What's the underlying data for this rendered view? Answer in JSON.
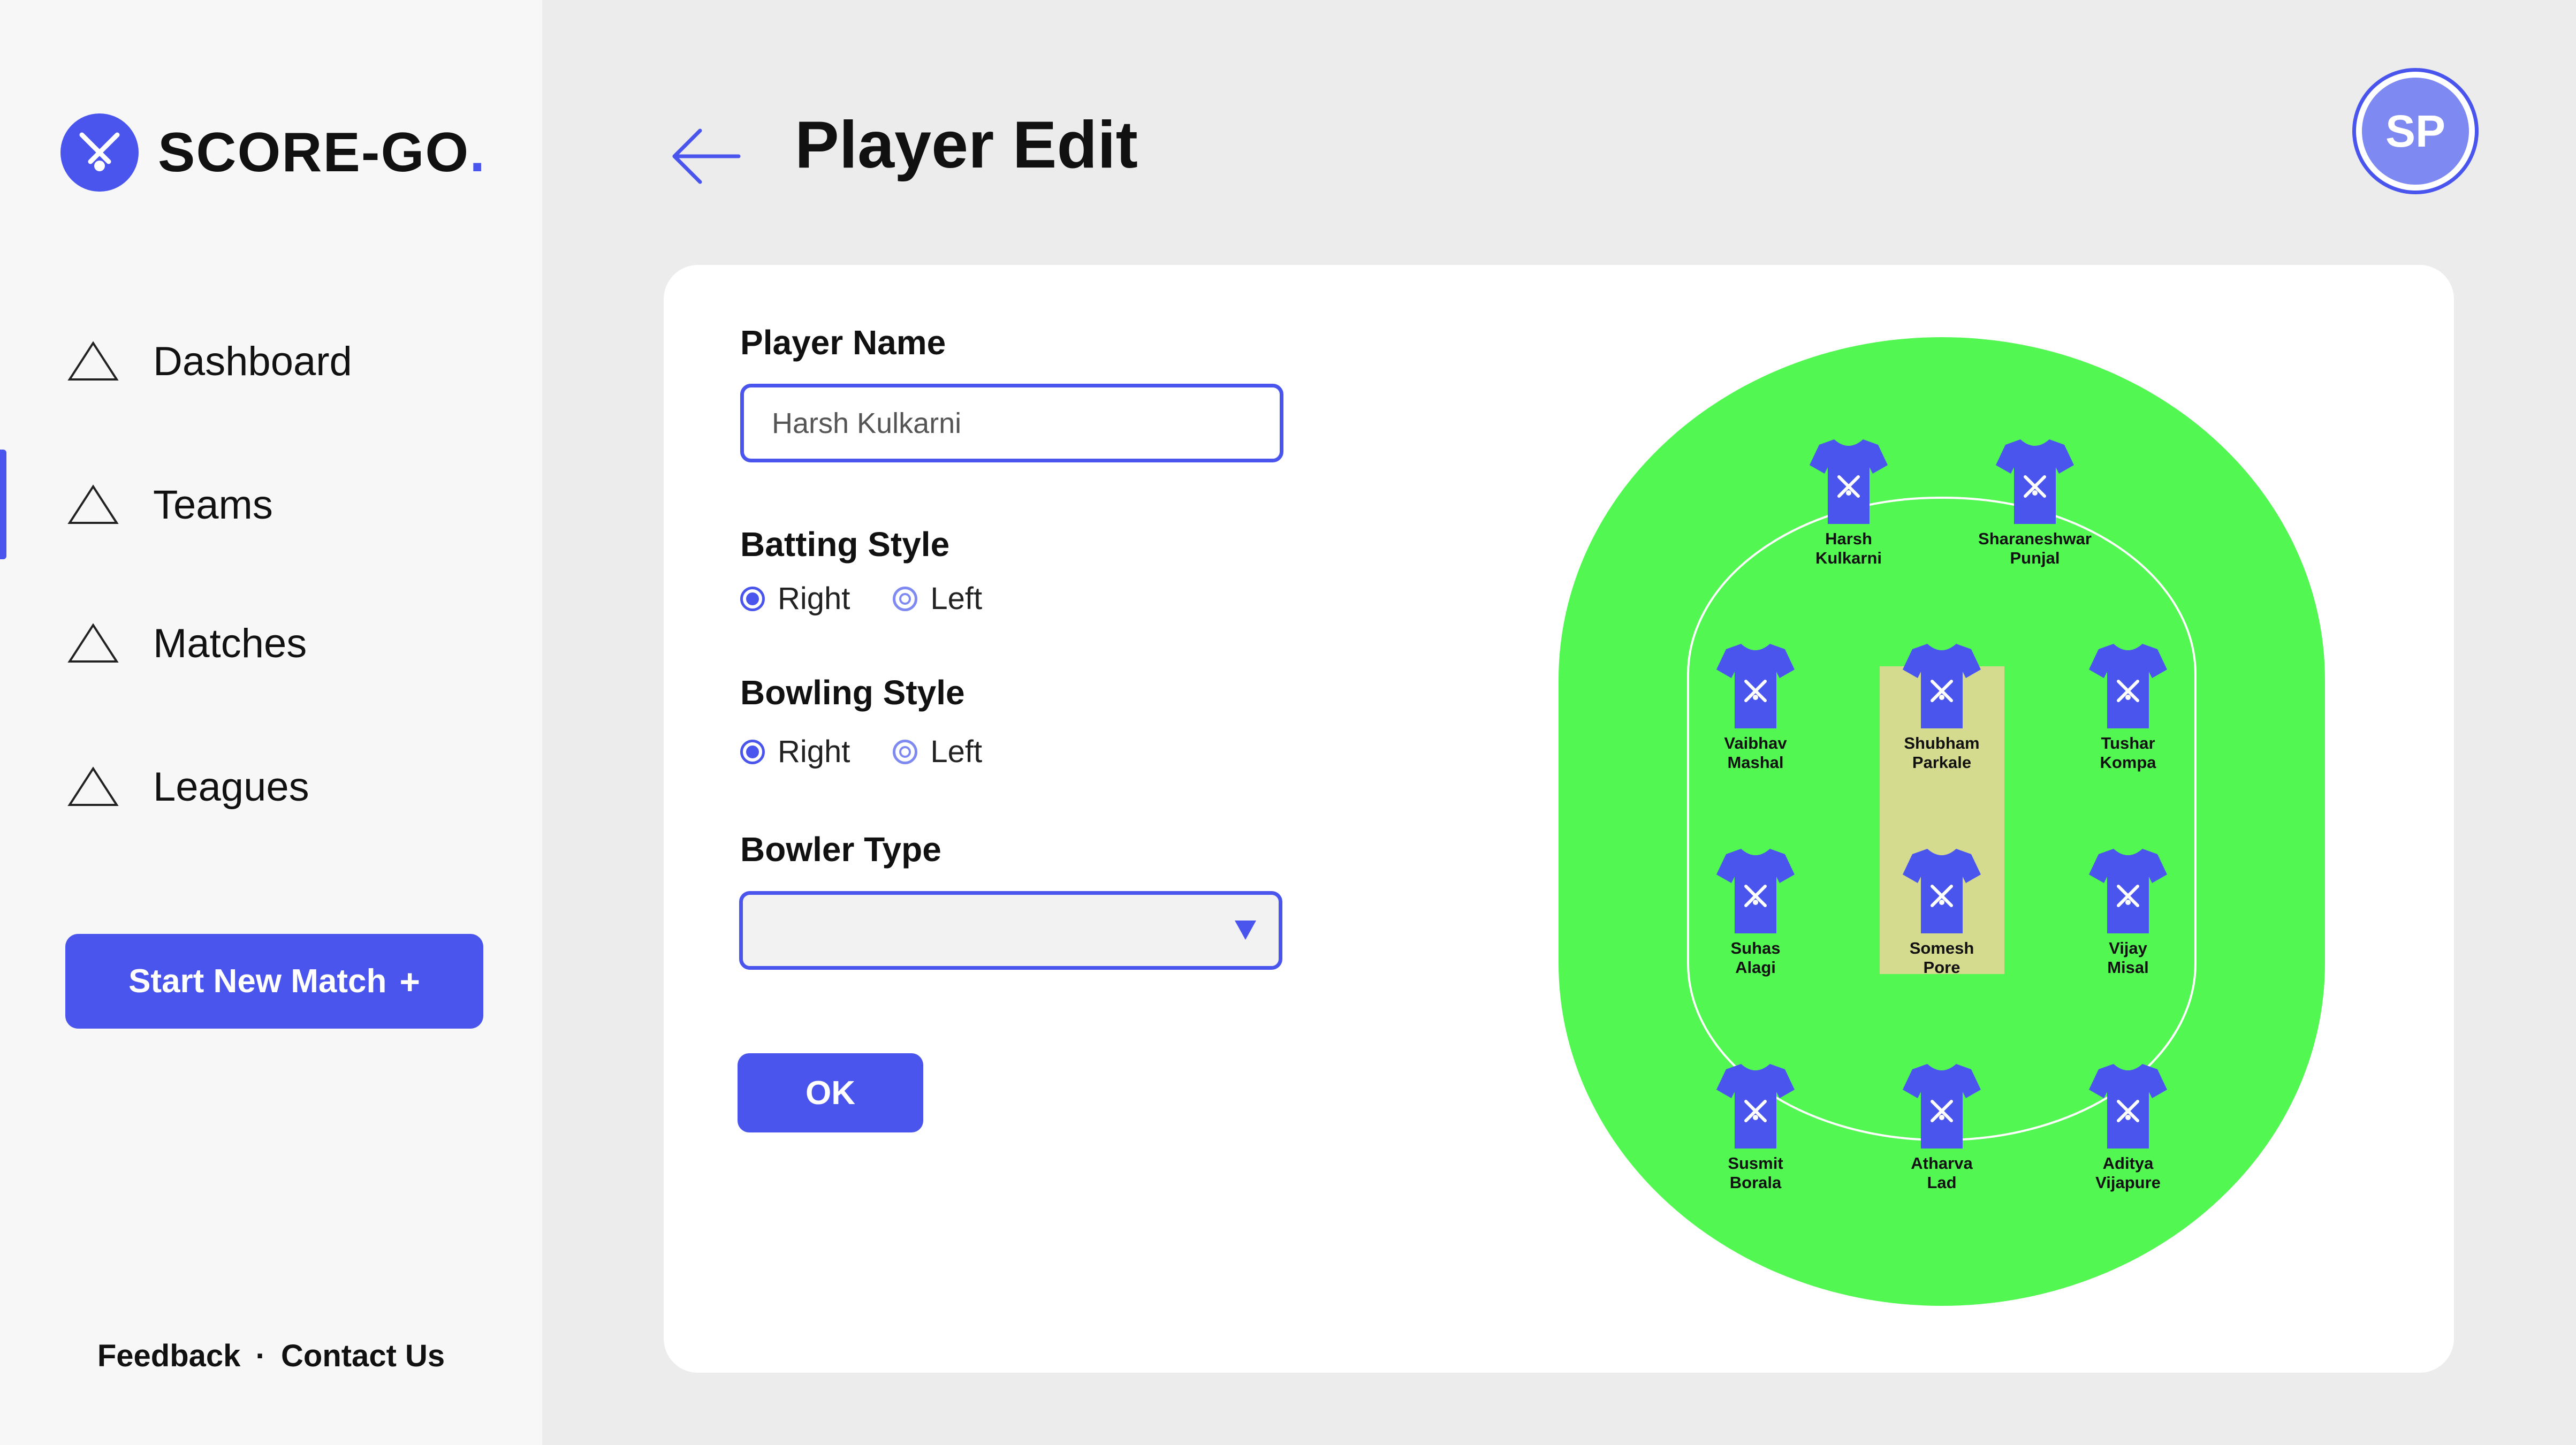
{
  "app": {
    "brand_name": "SCORE-GO",
    "brand_dot": ".",
    "accent_color": "#4a55ee",
    "logo_icon": "cricket-bat-ball-icon"
  },
  "sidebar": {
    "items": [
      {
        "label": "Dashboard",
        "icon": "triangle-icon",
        "active": false
      },
      {
        "label": "Teams",
        "icon": "triangle-icon",
        "active": true
      },
      {
        "label": "Matches",
        "icon": "triangle-icon",
        "active": false
      },
      {
        "label": "Leagues",
        "icon": "triangle-icon",
        "active": false
      }
    ],
    "start_match_label": "Start New Match",
    "start_match_icon": "+",
    "footer": {
      "feedback": "Feedback",
      "separator": "·",
      "contact": "Contact Us"
    }
  },
  "header": {
    "title": "Player Edit",
    "back_icon": "back-arrow-icon",
    "avatar_initials": "SP"
  },
  "form": {
    "player_name_label": "Player Name",
    "player_name_value": "Harsh Kulkarni",
    "batting_style_label": "Batting Style",
    "batting_options": [
      "Right",
      "Left"
    ],
    "batting_selected": "Right",
    "bowling_style_label": "Bowling Style",
    "bowling_options": [
      "Right",
      "Left"
    ],
    "bowling_selected": "Right",
    "bowler_type_label": "Bowler Type",
    "bowler_type_value": "",
    "ok_label": "OK"
  },
  "field": {
    "ground_color": "#52f752",
    "pitch_color": "#d4db8f",
    "jersey_color": "#4a55ee",
    "players": [
      {
        "name": "Harsh\nKulkarni"
      },
      {
        "name": "Sharaneshwar\nPunjal"
      },
      {
        "name": "Vaibhav\nMashal"
      },
      {
        "name": "Shubham\nParkale"
      },
      {
        "name": "Tushar\nKompa"
      },
      {
        "name": "Suhas\nAlagi"
      },
      {
        "name": "Somesh\nPore"
      },
      {
        "name": "Vijay\nMisal"
      },
      {
        "name": "Susmit\nBorala"
      },
      {
        "name": "Atharva\nLad"
      },
      {
        "name": "Aditya\nVijapure"
      }
    ]
  }
}
